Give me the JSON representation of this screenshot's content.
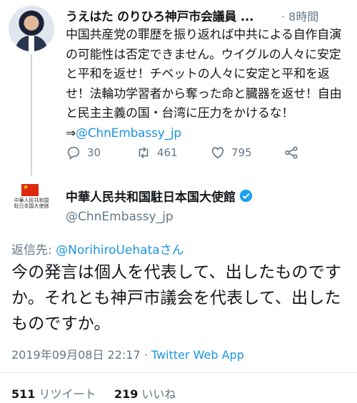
{
  "tweet1": {
    "author_name": "うえはた のりひろ神戸市会議員 ...",
    "time": "· 8時間",
    "text": "中国共産党の罪歴を振り返れば中共による自作自演の可能性は否定できません。ウイグルの人々に安定と平和を返せ！チベットの人々に安定と平和を返せ！法輪功学習者から奪った命と臓器を返せ！自由と民主主義の国・台湾に圧力をかけるな！⇒",
    "mention": "@ChnEmbassy_jp",
    "replies": "30",
    "retweets": "461",
    "likes": "795"
  },
  "tweet2": {
    "author_name": "中華人民共和国駐日本国大使館",
    "handle": "@ChnEmbassy_jp",
    "avatar_caption": "中華人民共和国駐日本国大使館",
    "reply_prefix": "返信先: ",
    "reply_to": "@NorihiroUehataさん",
    "text": "今の発言は個人を代表して、出したものですか。それとも神戸市議会を代表して、出したものですか。",
    "timestamp": "2019年09月08日 22:17 · ",
    "source": "Twitter Web App",
    "retweet_count": "511",
    "retweet_label": " リツイート",
    "like_count": "219",
    "like_label": " いいね"
  },
  "colors": {
    "link": "#1b95e0",
    "muted": "#657786",
    "flag": "#de2910"
  }
}
